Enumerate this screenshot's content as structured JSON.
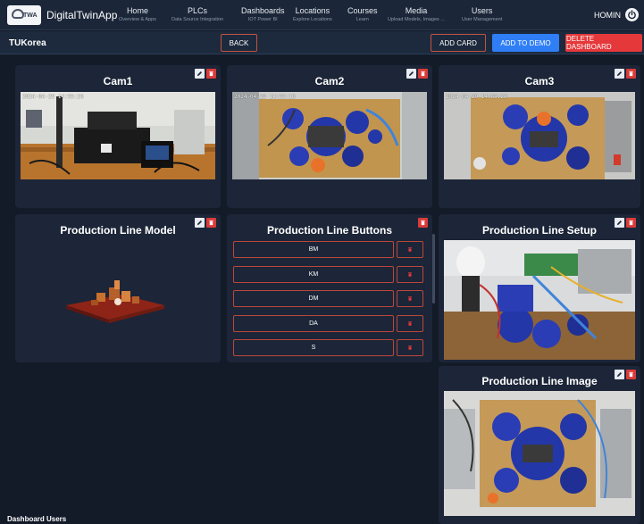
{
  "app": {
    "brand": "DigitalTwinApp",
    "logo_tag": "TWA"
  },
  "nav": [
    {
      "title": "Home",
      "sub": "Overview & Apps"
    },
    {
      "title": "PLCs",
      "sub": "Data Source Integration"
    },
    {
      "title": "Dashboards",
      "sub": "IOT Power BI"
    },
    {
      "title": "Locations",
      "sub": "Explore Locations"
    },
    {
      "title": "Courses",
      "sub": "Learn"
    },
    {
      "title": "Media",
      "sub": "Upload Models, Images ..."
    },
    {
      "title": "Users",
      "sub": "User Management"
    }
  ],
  "user": {
    "name": "HOMIN",
    "icon": "power-icon"
  },
  "subbar": {
    "org": "TUKorea",
    "back": "BACK",
    "add_card": "ADD CARD",
    "add_demo": "ADD TO DEMO",
    "delete_dashboard": "DELETE DASHBOARD"
  },
  "cards": {
    "cam1": {
      "title": "Cam1",
      "timestamp": "2024-04-29 14:55:26"
    },
    "cam2": {
      "title": "Cam2",
      "timestamp": "2024-04-29 14:55:16"
    },
    "cam3": {
      "title": "Cam3",
      "timestamp": "2024-04-29 14:55:26"
    },
    "model": {
      "title": "Production Line Model"
    },
    "buttons": {
      "title": "Production Line Buttons",
      "items": [
        "BM",
        "KM",
        "DM",
        "DA",
        "S"
      ]
    },
    "setup": {
      "title": "Production Line Setup"
    },
    "image": {
      "title": "Production Line Image"
    }
  },
  "footer": {
    "label": "Dashboard Users"
  },
  "colors": {
    "background": "#131b29",
    "card": "#1c2638",
    "accent_blue": "#2f7ef5",
    "accent_red": "#e5383b",
    "outline": "#b9483a"
  },
  "icons": {
    "edit": "pencil-icon",
    "delete": "trash-icon"
  }
}
